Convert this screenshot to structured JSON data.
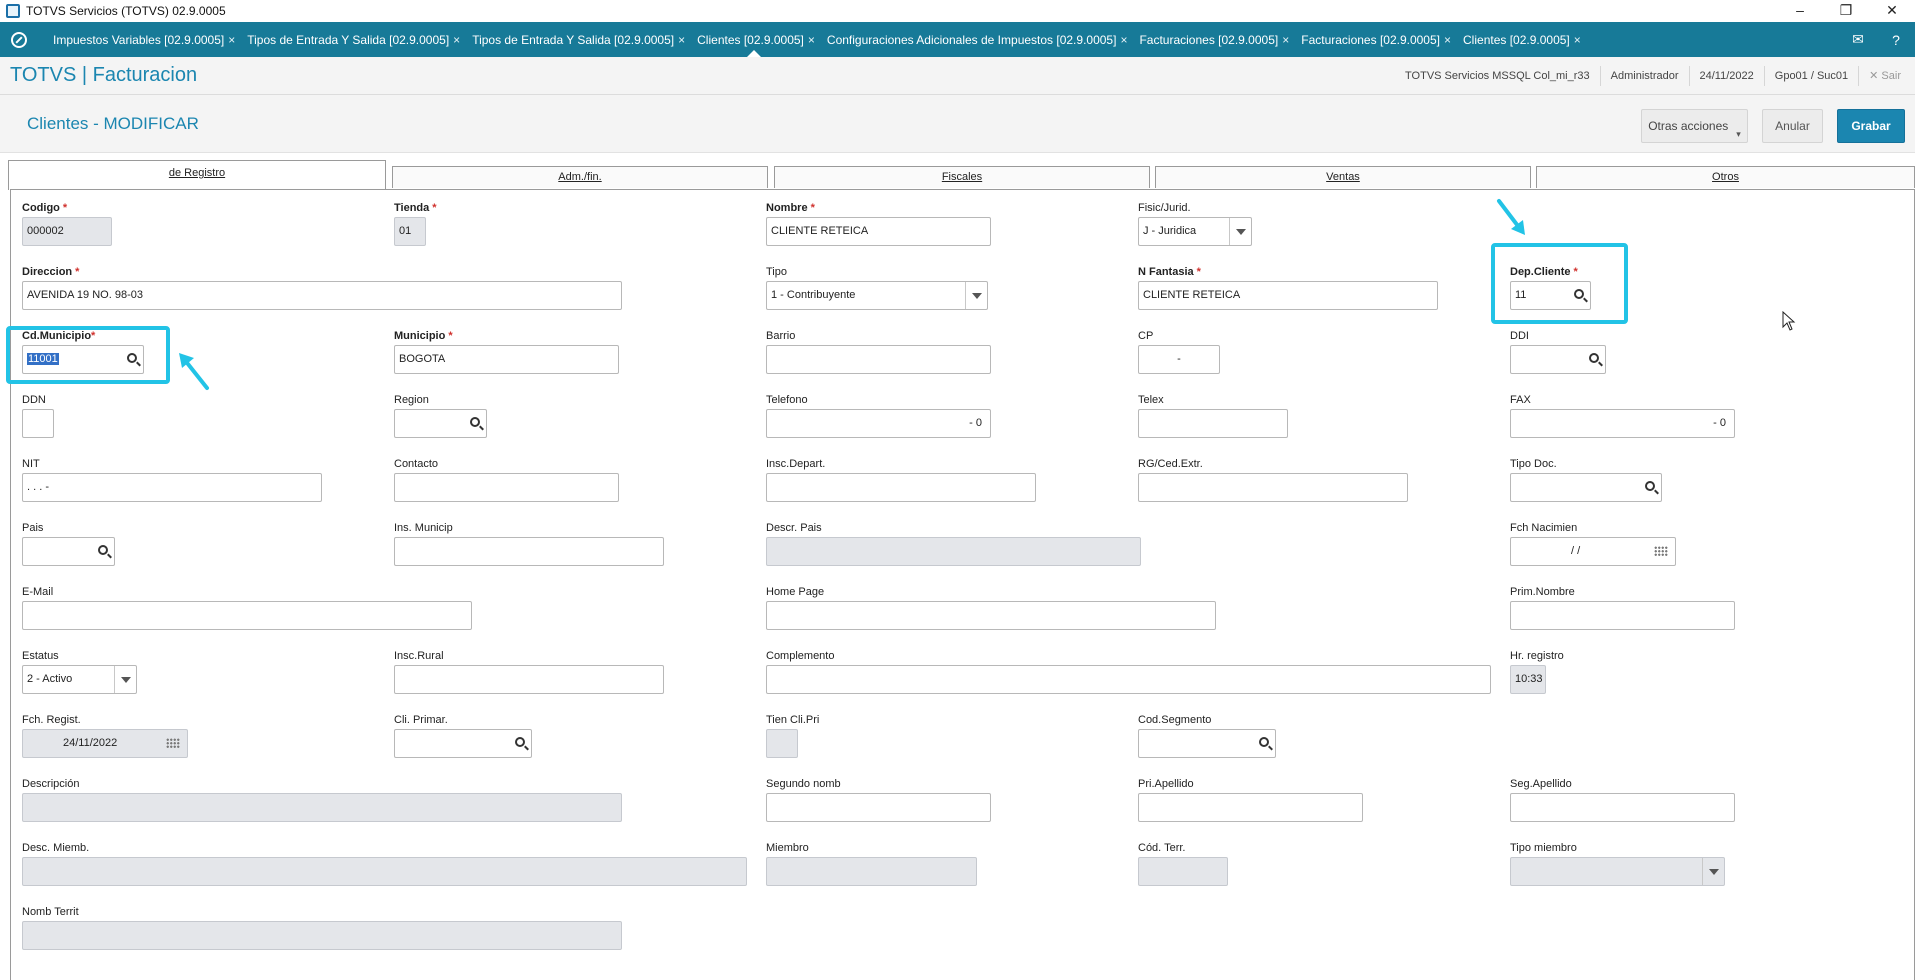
{
  "window": {
    "title": "TOTVS Servicios (TOTVS) 02.9.0005",
    "minimize": "–",
    "maximize": "❐",
    "close": "✕"
  },
  "tabs": [
    {
      "label": "Impuestos Variables [02.9.0005]",
      "close": "×"
    },
    {
      "label": "Tipos de Entrada Y Salida [02.9.0005]",
      "close": "×"
    },
    {
      "label": "Tipos de Entrada Y Salida [02.9.0005]",
      "close": "×"
    },
    {
      "label": "Clientes [02.9.0005]",
      "close": "×"
    },
    {
      "label": "Configuraciones Adicionales de Impuestos [02.9.0005]",
      "close": "×"
    },
    {
      "label": "Facturaciones [02.9.0005]",
      "close": "×"
    },
    {
      "label": "Facturaciones [02.9.0005]",
      "close": "×"
    },
    {
      "label": "Clientes [02.9.0005]",
      "close": "×"
    }
  ],
  "tabbar_icons": {
    "mail": "✉",
    "help": "?"
  },
  "header": {
    "brand": "TOTVS | Facturacion",
    "environment": "TOTVS Servicios MSSQL Col_mi_r33",
    "user": "Administrador",
    "date": "24/11/2022",
    "branch": "Gpo01 / Suc01",
    "exit": "✕  Sair"
  },
  "page": {
    "title": "Clientes - MODIFICAR",
    "other_actions": "Otras acciones",
    "other_caret": "▾",
    "cancel": "Anular",
    "save": "Grabar"
  },
  "folders": [
    "de Registro",
    "Adm./fin.",
    "Fiscales",
    "Ventas",
    "Otros"
  ],
  "fields": {
    "codigo": {
      "label": "Codigo",
      "value": "000002"
    },
    "tienda": {
      "label": "Tienda",
      "value": "01"
    },
    "nombre": {
      "label": "Nombre",
      "value": "CLIENTE RETEICA"
    },
    "fisic": {
      "label": "Fisic/Jurid.",
      "value": "J - Juridica"
    },
    "direccion": {
      "label": "Direccion",
      "value": "AVENIDA 19 NO. 98-03"
    },
    "tipo": {
      "label": "Tipo",
      "value": "1 - Contribuyente"
    },
    "nfantasia": {
      "label": "N Fantasia",
      "value": "CLIENTE RETEICA"
    },
    "depcliente": {
      "label": "Dep.Cliente",
      "value": "11"
    },
    "cdmunicipio": {
      "label": "Cd.Municipio",
      "value": "11001"
    },
    "municipio": {
      "label": "Municipio",
      "value": "BOGOTA"
    },
    "barrio": {
      "label": "Barrio",
      "value": ""
    },
    "cp": {
      "label": "CP",
      "value": "-"
    },
    "ddi": {
      "label": "DDI",
      "value": ""
    },
    "ddn": {
      "label": "DDN",
      "value": ""
    },
    "region": {
      "label": "Region",
      "value": ""
    },
    "telefono": {
      "label": "Telefono",
      "value": "-  0"
    },
    "telex": {
      "label": "Telex",
      "value": ""
    },
    "fax": {
      "label": "FAX",
      "value": "-  0"
    },
    "nit": {
      "label": "NIT",
      "value": " .  .  .  -"
    },
    "contacto": {
      "label": "Contacto",
      "value": ""
    },
    "inscdepart": {
      "label": "Insc.Depart.",
      "value": ""
    },
    "rgced": {
      "label": "RG/Ced.Extr.",
      "value": ""
    },
    "tipodoc": {
      "label": "Tipo Doc.",
      "value": ""
    },
    "pais": {
      "label": "Pais",
      "value": ""
    },
    "insmunicip": {
      "label": "Ins. Municip",
      "value": ""
    },
    "descrpais": {
      "label": "Descr. Pais",
      "value": ""
    },
    "fchnacimien": {
      "label": "Fch Nacimien",
      "value": "/ /"
    },
    "email": {
      "label": "E-Mail",
      "value": ""
    },
    "homepage": {
      "label": "Home Page",
      "value": ""
    },
    "primnombre": {
      "label": "Prim.Nombre",
      "value": ""
    },
    "estatus": {
      "label": "Estatus",
      "value": "2 - Activo"
    },
    "inscrural": {
      "label": "Insc.Rural",
      "value": ""
    },
    "complemento": {
      "label": "Complemento",
      "value": ""
    },
    "hrregistro": {
      "label": "Hr. registro",
      "value": "10:33"
    },
    "fchregist": {
      "label": "Fch. Regist.",
      "value": "24/11/2022"
    },
    "cliprimar": {
      "label": "Cli. Primar.",
      "value": ""
    },
    "tiencli": {
      "label": "Tien Cli.Pri",
      "value": ""
    },
    "codsegmento": {
      "label": "Cod.Segmento",
      "value": ""
    },
    "descripcion": {
      "label": "Descripción",
      "value": ""
    },
    "segundonomb": {
      "label": "Segundo nomb",
      "value": ""
    },
    "priapellido": {
      "label": "Pri.Apellido",
      "value": ""
    },
    "segapellido": {
      "label": "Seg.Apellido",
      "value": ""
    },
    "descmiemb": {
      "label": "Desc. Miemb.",
      "value": ""
    },
    "miembro": {
      "label": "Miembro",
      "value": ""
    },
    "codterr": {
      "label": "Cód. Terr.",
      "value": ""
    },
    "tipomiembro": {
      "label": "Tipo miembro",
      "value": ""
    },
    "nombterrit": {
      "label": "Nomb Territ",
      "value": ""
    }
  },
  "required_marker": "*",
  "colors": {
    "accent": "#1b86b0",
    "highlight": "#22c3e6",
    "required": "#d0312d"
  }
}
